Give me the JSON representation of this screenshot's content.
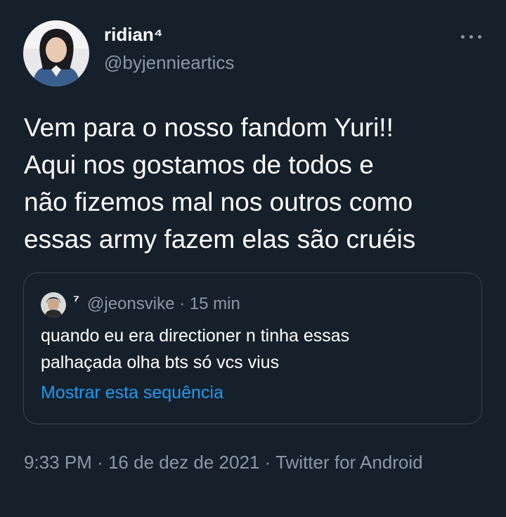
{
  "author": {
    "display_name": "ridian⁴",
    "handle": "@byjennieartics"
  },
  "tweet": {
    "text": "Vem para o nosso fandom Yuri!!\nAqui nos gostamos de todos e\nnão fizemos mal nos outros como\nessas army fazem elas são cruéis"
  },
  "quote": {
    "display_name": "⁷",
    "handle": "@jeonsvike",
    "separator": "·",
    "time_ago": "15 min",
    "text": "quando eu era directioner n tinha essas\npalhaçada olha bts só vcs vius",
    "show_thread_label": "Mostrar esta sequência"
  },
  "footer": {
    "time": "9:33 PM",
    "date": "16 de dez de 2021",
    "client": "Twitter for Android",
    "separator": "·"
  },
  "icons": {
    "more": "more-horizontal-icon"
  },
  "colors": {
    "background": "#15202b",
    "text_primary": "#ffffff",
    "text_secondary": "#8b98a5",
    "link": "#1d9bf0",
    "border": "#38444d"
  }
}
